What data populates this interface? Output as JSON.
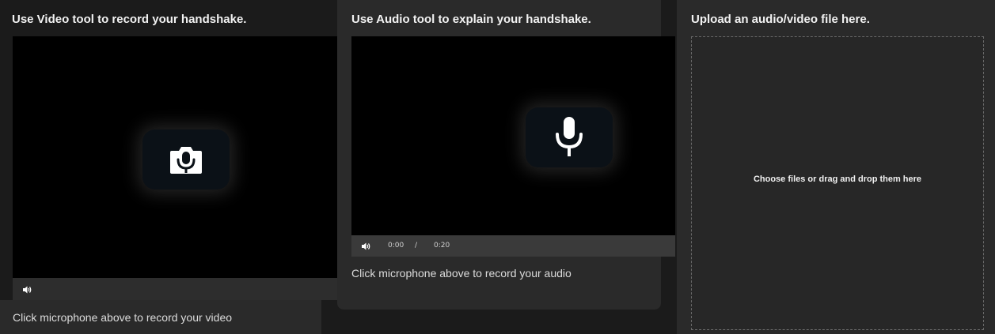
{
  "video_panel": {
    "title": "Use Video tool to record your handshake.",
    "record_button_icon": "camera-microphone-icon",
    "volume_icon": "volume-icon",
    "hint": "Click microphone above to record your video"
  },
  "audio_panel": {
    "title": "Use Audio tool to explain your handshake.",
    "record_button_icon": "microphone-icon",
    "volume_icon": "volume-icon",
    "time_current": "0:00",
    "time_separator": "/",
    "time_total": "0:20",
    "hint": "Click microphone above to record your audio"
  },
  "upload_panel": {
    "title": "Upload an audio/video file here.",
    "dropzone_text": "Choose files or drag and drop them here"
  },
  "colors": {
    "page_bg": "#1b1b1b",
    "panel_bg": "#2a2a2a",
    "screen_bg": "#000000",
    "button_bg": "#0b1117",
    "text": "#f2f2f2"
  }
}
